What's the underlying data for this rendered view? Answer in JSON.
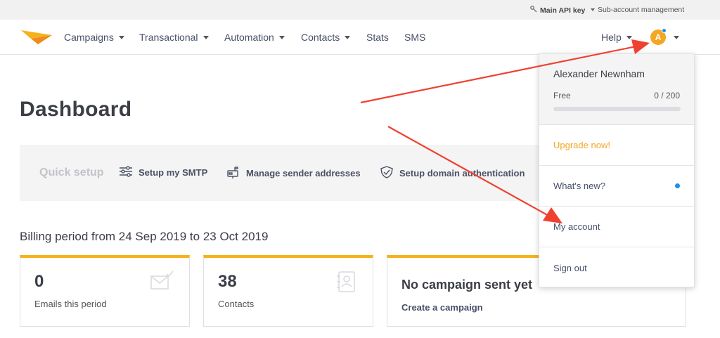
{
  "topbar": {
    "api_key_label": "Main API key",
    "subaccount_label": "Sub-account management"
  },
  "nav": {
    "items": [
      {
        "label": "Campaigns",
        "dropdown": true
      },
      {
        "label": "Transactional",
        "dropdown": true
      },
      {
        "label": "Automation",
        "dropdown": true
      },
      {
        "label": "Contacts",
        "dropdown": true
      },
      {
        "label": "Stats",
        "dropdown": false
      },
      {
        "label": "SMS",
        "dropdown": false
      }
    ],
    "help_label": "Help",
    "avatar_initial": "A"
  },
  "page": {
    "title": "Dashboard"
  },
  "quick_setup": {
    "label": "Quick setup",
    "items": [
      {
        "label": "Setup my SMTP",
        "icon": "sliders-icon"
      },
      {
        "label": "Manage sender addresses",
        "icon": "mailbox-icon"
      },
      {
        "label": "Setup domain authentication",
        "icon": "shield-check-icon"
      }
    ]
  },
  "billing": {
    "period_text": "Billing period from 24 Sep 2019 to 23 Oct 2019"
  },
  "cards": {
    "emails": {
      "value": "0",
      "label": "Emails this period"
    },
    "contacts": {
      "value": "38",
      "label": "Contacts"
    },
    "campaign": {
      "title": "No campaign sent yet",
      "link": "Create a campaign"
    }
  },
  "account_menu": {
    "name": "Alexander Newnham",
    "plan": "Free",
    "quota": "0 / 200",
    "upgrade": "Upgrade now!",
    "whats_new": "What's new?",
    "my_account": "My account",
    "sign_out": "Sign out"
  },
  "colors": {
    "accent": "#f6b21b",
    "avatar": "#f5a623",
    "notification": "#1f8fe8",
    "annotation_arrow": "#f04130"
  }
}
